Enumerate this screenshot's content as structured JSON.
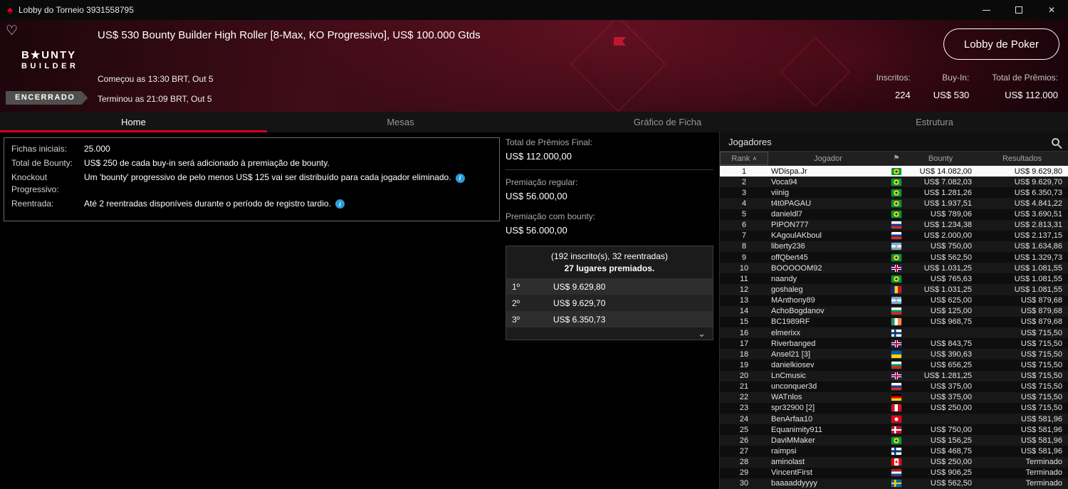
{
  "window": {
    "title": "Lobby do Torneio 3931558795"
  },
  "icons": {
    "spade": "♠",
    "heart": "♡",
    "close": "✕",
    "info": "i",
    "chevron_down": "⌄",
    "sort_asc": "˄",
    "flag_header": "⚑"
  },
  "header": {
    "logo_line1": "B★UNTY",
    "logo_line2": "BUILDER",
    "title": "US$ 530 Bounty Builder High Roller [8-Max, KO Progressivo], US$ 100.000 Gtds",
    "started": "Começou as 13:30 BRT, Out 5",
    "status_badge": "ENCERRADO",
    "ended": "Terminou as 21:09 BRT, Out 5",
    "lobby_button": "Lobby de Poker",
    "stats": [
      {
        "label": "Inscritos:",
        "value": "224"
      },
      {
        "label": "Buy-In:",
        "value": "US$ 530"
      },
      {
        "label": "Total de Prêmios:",
        "value": "US$ 112.000"
      }
    ]
  },
  "tabs": [
    {
      "label": "Home",
      "active": true
    },
    {
      "label": "Mesas",
      "active": false
    },
    {
      "label": "Gráfico de Ficha",
      "active": false
    },
    {
      "label": "Estrutura",
      "active": false
    }
  ],
  "info": {
    "rows": [
      {
        "label": "Fichas iniciais:",
        "value": "25.000",
        "info": false
      },
      {
        "label": "Total de Bounty:",
        "value": "US$ 250 de cada buy-in será adicionado à premiação de bounty.",
        "info": false
      },
      {
        "label": "Knockout Progressivo:",
        "value": "Um 'bounty' progressivo de pelo menos US$ 125 vai ser distribuído para cada jogador eliminado.",
        "info": true
      },
      {
        "label": "Reentrada:",
        "value": "Até 2 reentradas disponíveis durante o período de registro tardio.",
        "info": true
      }
    ]
  },
  "prizes": {
    "total_label": "Total de Prêmios Final:",
    "total_value": "US$ 112.000,00",
    "regular_label": "Premiação regular:",
    "regular_value": "US$ 56.000,00",
    "bounty_label": "Premiação com bounty:",
    "bounty_value": "US$ 56.000,00",
    "entries_line": "(192 inscrito(s), 32 reentradas)",
    "places_line": "27 lugares premiados.",
    "payouts": [
      {
        "place": "1º",
        "amount": "US$ 9.629,80"
      },
      {
        "place": "2º",
        "amount": "US$ 9.629,70"
      },
      {
        "place": "3º",
        "amount": "US$ 6.350,73"
      }
    ]
  },
  "players": {
    "panel_title": "Jogadores",
    "columns": [
      "Rank",
      "Jogador",
      "Bounty",
      "Resultados"
    ],
    "rows": [
      {
        "rank": "1",
        "name": "WDispa.Jr",
        "flag": "br",
        "bounty": "US$ 14.082,00",
        "result": "US$ 9.629,80",
        "highlight": true
      },
      {
        "rank": "2",
        "name": "Voca94",
        "flag": "br",
        "bounty": "US$ 7.082,03",
        "result": "US$ 9.629,70",
        "highlight": false
      },
      {
        "rank": "3",
        "name": "viinig",
        "flag": "br",
        "bounty": "US$ 1.281,26",
        "result": "US$ 6.350,73",
        "highlight": false
      },
      {
        "rank": "4",
        "name": "t4t0PAGAU",
        "flag": "br",
        "bounty": "US$ 1.937,51",
        "result": "US$ 4.841,22",
        "highlight": false
      },
      {
        "rank": "5",
        "name": "danieldl7",
        "flag": "br",
        "bounty": "US$ 789,06",
        "result": "US$ 3.690,51",
        "highlight": false
      },
      {
        "rank": "6",
        "name": "PIPON777",
        "flag": "ru",
        "bounty": "US$ 1.234,38",
        "result": "US$ 2.813,31",
        "highlight": false
      },
      {
        "rank": "7",
        "name": "KAgoulAKboul",
        "flag": "ru",
        "bounty": "US$ 2.000,00",
        "result": "US$ 2.137,15",
        "highlight": false
      },
      {
        "rank": "8",
        "name": "liberty236",
        "flag": "ar",
        "bounty": "US$ 750,00",
        "result": "US$ 1.634,86",
        "highlight": false
      },
      {
        "rank": "9",
        "name": "offQbert45",
        "flag": "br",
        "bounty": "US$ 562,50",
        "result": "US$ 1.329,73",
        "highlight": false
      },
      {
        "rank": "10",
        "name": "BOOOOOM92",
        "flag": "gb",
        "bounty": "US$ 1.031,25",
        "result": "US$ 1.081,55",
        "highlight": false
      },
      {
        "rank": "11",
        "name": "naandy",
        "flag": "br",
        "bounty": "US$ 765,63",
        "result": "US$ 1.081,55",
        "highlight": false
      },
      {
        "rank": "12",
        "name": "goshaleg",
        "flag": "ro",
        "bounty": "US$ 1.031,25",
        "result": "US$ 1.081,55",
        "highlight": false
      },
      {
        "rank": "13",
        "name": "MAnthony89",
        "flag": "ar",
        "bounty": "US$ 625,00",
        "result": "US$ 879,68",
        "highlight": false
      },
      {
        "rank": "14",
        "name": "AchoBogdanov",
        "flag": "bg",
        "bounty": "US$ 125,00",
        "result": "US$ 879,68",
        "highlight": false
      },
      {
        "rank": "15",
        "name": "BC1989RF",
        "flag": "ie",
        "bounty": "US$ 968,75",
        "result": "US$ 879,68",
        "highlight": false
      },
      {
        "rank": "16",
        "name": "elmerixx",
        "flag": "fi",
        "bounty": "",
        "result": "US$ 715,50",
        "highlight": false
      },
      {
        "rank": "17",
        "name": "Riverbanged",
        "flag": "gb",
        "bounty": "US$ 843,75",
        "result": "US$ 715,50",
        "highlight": false
      },
      {
        "rank": "18",
        "name": "Ansel21 [3]",
        "flag": "ua",
        "bounty": "US$ 390,63",
        "result": "US$ 715,50",
        "highlight": false
      },
      {
        "rank": "19",
        "name": "danielkiosev",
        "flag": "bg",
        "bounty": "US$ 656,25",
        "result": "US$ 715,50",
        "highlight": false
      },
      {
        "rank": "20",
        "name": "LnCmusic",
        "flag": "gb",
        "bounty": "US$ 1.281,25",
        "result": "US$ 715,50",
        "highlight": false
      },
      {
        "rank": "21",
        "name": "unconquer3d",
        "flag": "ru",
        "bounty": "US$ 375,00",
        "result": "US$ 715,50",
        "highlight": false
      },
      {
        "rank": "22",
        "name": "WATnlos",
        "flag": "de",
        "bounty": "US$ 375,00",
        "result": "US$ 715,50",
        "highlight": false
      },
      {
        "rank": "23",
        "name": "spr32900 [2]",
        "flag": "pe",
        "bounty": "US$ 250,00",
        "result": "US$ 715,50",
        "highlight": false
      },
      {
        "rank": "24",
        "name": "BenArfaa10",
        "flag": "tn",
        "bounty": "",
        "result": "US$ 581,96",
        "highlight": false
      },
      {
        "rank": "25",
        "name": "Equanimity911",
        "flag": "dk",
        "bounty": "US$ 750,00",
        "result": "US$ 581,96",
        "highlight": false
      },
      {
        "rank": "26",
        "name": "DaviMMaker",
        "flag": "br",
        "bounty": "US$ 156,25",
        "result": "US$ 581,96",
        "highlight": false
      },
      {
        "rank": "27",
        "name": "raimpsi",
        "flag": "fi",
        "bounty": "US$ 468,75",
        "result": "US$ 581,96",
        "highlight": false
      },
      {
        "rank": "28",
        "name": "aminolast",
        "flag": "ca",
        "bounty": "US$ 250,00",
        "result": "Terminado",
        "highlight": false
      },
      {
        "rank": "29",
        "name": "VincentFirst",
        "flag": "nl",
        "bounty": "US$ 906,25",
        "result": "Terminado",
        "highlight": false
      },
      {
        "rank": "30",
        "name": "baaaaddyyyy",
        "flag": "se",
        "bounty": "US$ 562,50",
        "result": "Terminado",
        "highlight": false
      }
    ]
  }
}
